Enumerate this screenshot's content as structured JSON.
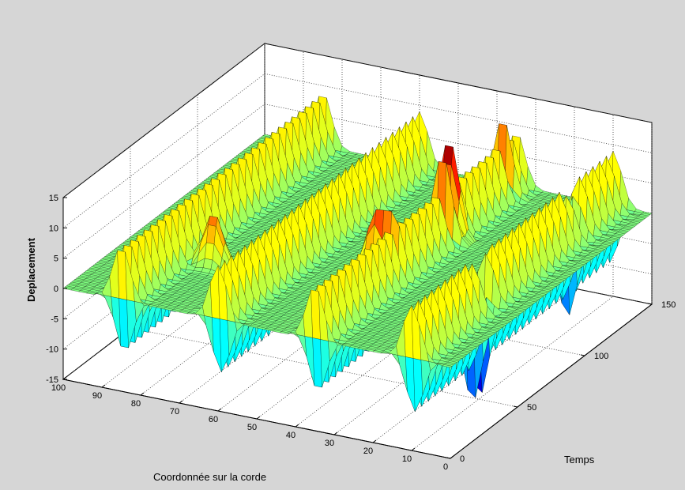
{
  "chart_data": {
    "type": "surface",
    "title": "",
    "xlabel": "Temps",
    "ylabel": "Coordonnée sur la corde",
    "zlabel": "Deplacement",
    "xlim": [
      0,
      150
    ],
    "ylim": [
      0,
      100
    ],
    "zlim": [
      -15,
      15
    ],
    "xticks": [
      0,
      50,
      100,
      150
    ],
    "yticks": [
      0,
      10,
      20,
      30,
      40,
      50,
      60,
      70,
      80,
      90,
      100
    ],
    "zticks": [
      -15,
      -10,
      -5,
      0,
      5,
      10,
      15
    ],
    "grid": true,
    "colormap": "jet",
    "ridges": [
      {
        "position": 10,
        "amplitude": 9
      },
      {
        "position": 35,
        "amplitude": 9
      },
      {
        "position": 60,
        "amplitude": 9
      },
      {
        "position": 85,
        "amplitude": 9
      }
    ],
    "ridge_period": 5,
    "peaks": [
      {
        "x": 98,
        "y": 35,
        "z": 14
      },
      {
        "x": 60,
        "y": 40,
        "z": 10
      },
      {
        "x": 40,
        "y": 75,
        "z": 9
      },
      {
        "x": 50,
        "y": 12,
        "z": -14
      },
      {
        "x": 118,
        "y": 12,
        "z": -5
      },
      {
        "x": 140,
        "y": 35,
        "z": 4
      }
    ]
  },
  "colors": {
    "figure_bg": "#d6d6d6",
    "axes_bg": "#ffffff",
    "grid": "#333333",
    "edge": "#000000"
  }
}
